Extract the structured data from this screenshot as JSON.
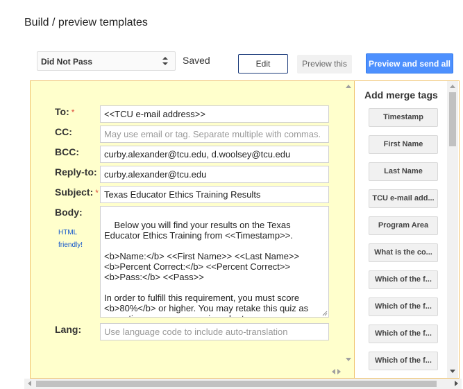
{
  "page": {
    "title": "Build / preview templates"
  },
  "toolbar": {
    "template_selected": "Did Not Pass",
    "saved_status": "Saved",
    "edit_label": "Edit",
    "preview_this_label": "Preview this",
    "preview_send_label": "Preview and send all"
  },
  "form": {
    "to": {
      "label": "To:",
      "value": "<<TCU e-mail address>>",
      "required": true
    },
    "cc": {
      "label": "CC:",
      "placeholder": "May use email or tag. Separate multiple with commas."
    },
    "bcc": {
      "label": "BCC:",
      "value": "curby.alexander@tcu.edu, d.woolsey@tcu.edu"
    },
    "reply_to": {
      "label": "Reply-to:",
      "value": "curby.alexander@tcu.edu"
    },
    "subject": {
      "label": "Subject:",
      "value": "Texas Educator Ethics Training Results",
      "required": true
    },
    "body": {
      "label": "Body:",
      "hint_line1": "HTML",
      "hint_line2": "friendly!",
      "value": "Below you will find your results on the Texas Educator Ethics Training from <<Timestamp>>.\n\n<b>Name:</b> <<First Name>> <<Last Name>>\n<b>Percent Correct:</b> <<Percent Correct>>\n<b>Pass:</b> <<Pass>>\n\nIn order to fulfill this requirement, you must score <b>80%</b> or higher. You may retake this quiz as many times as necessary in order to pass."
    },
    "lang": {
      "label": "Lang:",
      "placeholder": "Use language code to include auto-translation"
    },
    "required_marker": "*"
  },
  "merge_tags": {
    "title": "Add merge tags",
    "items": [
      "Timestamp",
      "First Name",
      "Last Name",
      "TCU e-mail add...",
      "Program Area",
      "What is the co...",
      "Which of the f...",
      "Which of the f...",
      "Which of the f...",
      "Which of the f..."
    ]
  },
  "colors": {
    "form_background": "#ffffcc",
    "panel_border": "#f0c36d",
    "primary_button": "#4d90fe",
    "required": "#dd4b39",
    "hint_link": "#1155cc"
  },
  "icons": {
    "select_arrows": "updown-chevron-icon",
    "textarea_resize": "resize-grip-icon"
  }
}
